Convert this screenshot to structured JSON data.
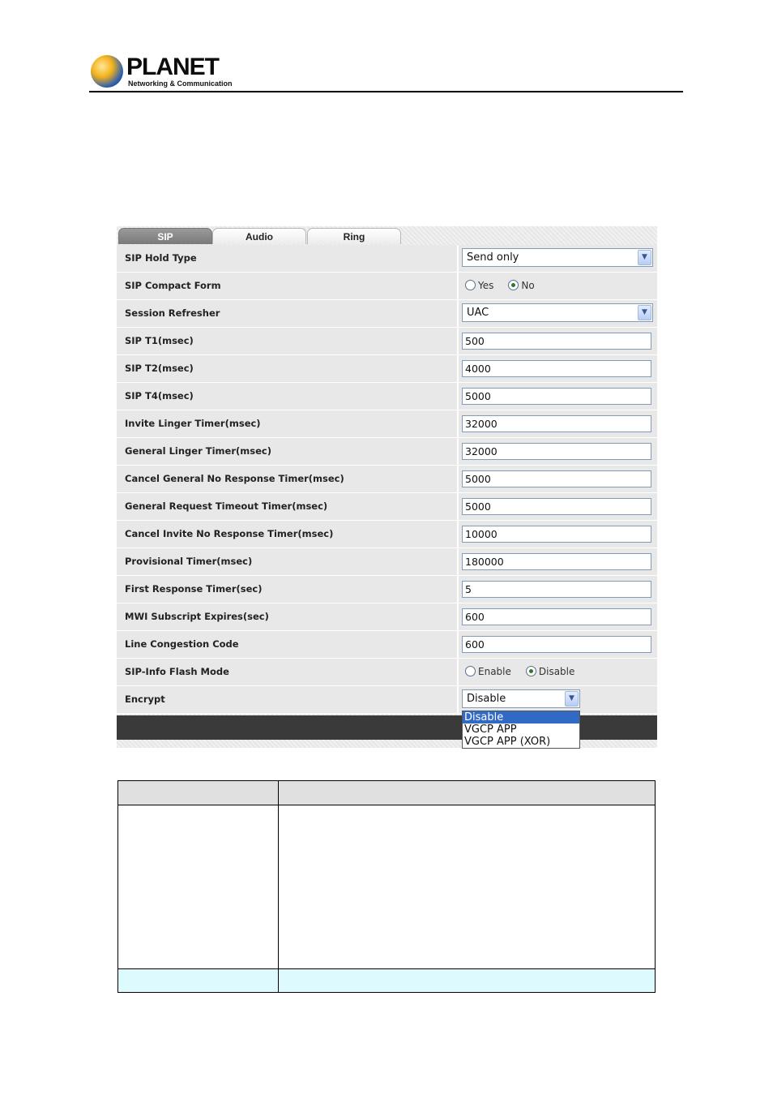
{
  "brand": {
    "name": "PLANET",
    "tagline": "Networking & Communication"
  },
  "tabs": [
    {
      "label": "SIP",
      "active": true
    },
    {
      "label": "Audio",
      "active": false
    },
    {
      "label": "Ring",
      "active": false
    }
  ],
  "rows": [
    {
      "label": "SIP Hold Type",
      "type": "select",
      "value": "Send only"
    },
    {
      "label": "SIP Compact Form",
      "type": "radio",
      "options": [
        "Yes",
        "No"
      ],
      "selected": "No"
    },
    {
      "label": "Session Refresher",
      "type": "select",
      "value": "UAC"
    },
    {
      "label": "SIP T1(msec)",
      "type": "text",
      "value": "500"
    },
    {
      "label": "SIP T2(msec)",
      "type": "text",
      "value": "4000"
    },
    {
      "label": "SIP T4(msec)",
      "type": "text",
      "value": "5000"
    },
    {
      "label": "Invite Linger Timer(msec)",
      "type": "text",
      "value": "32000"
    },
    {
      "label": "General Linger Timer(msec)",
      "type": "text",
      "value": "32000"
    },
    {
      "label": "Cancel General No Response Timer(msec)",
      "type": "text",
      "value": "5000"
    },
    {
      "label": "General Request Timeout Timer(msec)",
      "type": "text",
      "value": "5000"
    },
    {
      "label": "Cancel Invite No Response Timer(msec)",
      "type": "text",
      "value": "10000"
    },
    {
      "label": "Provisional Timer(msec)",
      "type": "text",
      "value": "180000"
    },
    {
      "label": "First Response Timer(sec)",
      "type": "text",
      "value": "5"
    },
    {
      "label": "MWI Subscript Expires(sec)",
      "type": "text",
      "value": "600"
    },
    {
      "label": "Line Congestion Code",
      "type": "text",
      "value": "600"
    },
    {
      "label": "SIP-Info Flash Mode",
      "type": "radio",
      "options": [
        "Enable",
        "Disable"
      ],
      "selected": "Disable"
    },
    {
      "label": "Encrypt",
      "type": "select-open",
      "value": "Disable"
    }
  ],
  "encrypt_options": [
    "Disable",
    "VGCP APP",
    "VGCP APP (XOR)"
  ],
  "encrypt_selected": "Disable"
}
